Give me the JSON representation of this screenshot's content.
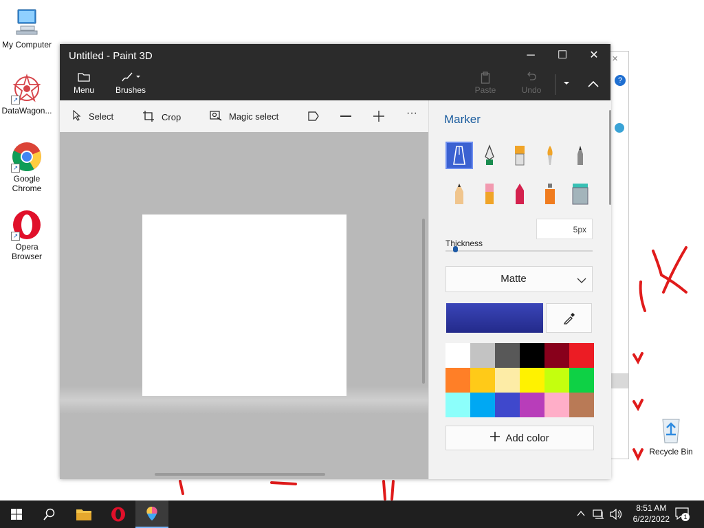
{
  "desktop": {
    "icons": [
      {
        "label": "My Computer",
        "icon": "computer-icon"
      },
      {
        "label": "DataWagon...",
        "icon": "datawagon-icon"
      },
      {
        "label": "Google Chrome",
        "icon": "chrome-icon"
      },
      {
        "label": "Opera Browser",
        "icon": "opera-icon"
      },
      {
        "label": "Recycle Bin",
        "icon": "recycle-bin-icon"
      }
    ]
  },
  "window": {
    "title": "Untitled - Paint 3D",
    "controls": {
      "minimize": "─",
      "maximize": "☐",
      "close": "✕"
    }
  },
  "ribbon": {
    "menu_label": "Menu",
    "brushes_label": "Brushes",
    "paste_label": "Paste",
    "undo_label": "Undo"
  },
  "toolbar": {
    "select_label": "Select",
    "crop_label": "Crop",
    "magic_select_label": "Magic select",
    "more_label": "···"
  },
  "panel": {
    "title": "Marker",
    "brushes": [
      {
        "name": "marker",
        "selected": true
      },
      {
        "name": "calligraphy-pen"
      },
      {
        "name": "oil-brush"
      },
      {
        "name": "watercolor"
      },
      {
        "name": "pixel-pen"
      },
      {
        "name": "pencil"
      },
      {
        "name": "eraser"
      },
      {
        "name": "crayon"
      },
      {
        "name": "spray-can"
      },
      {
        "name": "fill"
      }
    ],
    "thickness_label": "Thickness",
    "thickness_value": "5px",
    "thickness_level": 0.05,
    "finish_value": "Matte",
    "current_color": [
      "#3a45b8",
      "#232a8a"
    ],
    "palette": [
      "#ffffff",
      "#c3c3c3",
      "#585858",
      "#000000",
      "#88001b",
      "#ec1c24",
      "#ff7f27",
      "#ffca18",
      "#fdeca6",
      "#fff200",
      "#c4ff0e",
      "#0ed145",
      "#8cfffb",
      "#00a8f3",
      "#3f48cc",
      "#b83dba",
      "#ffaec8",
      "#b97a56"
    ],
    "add_color_label": "Add color"
  },
  "taskbar": {
    "time": "8:51 AM",
    "date": "6/22/2022",
    "notification_count": "1"
  }
}
